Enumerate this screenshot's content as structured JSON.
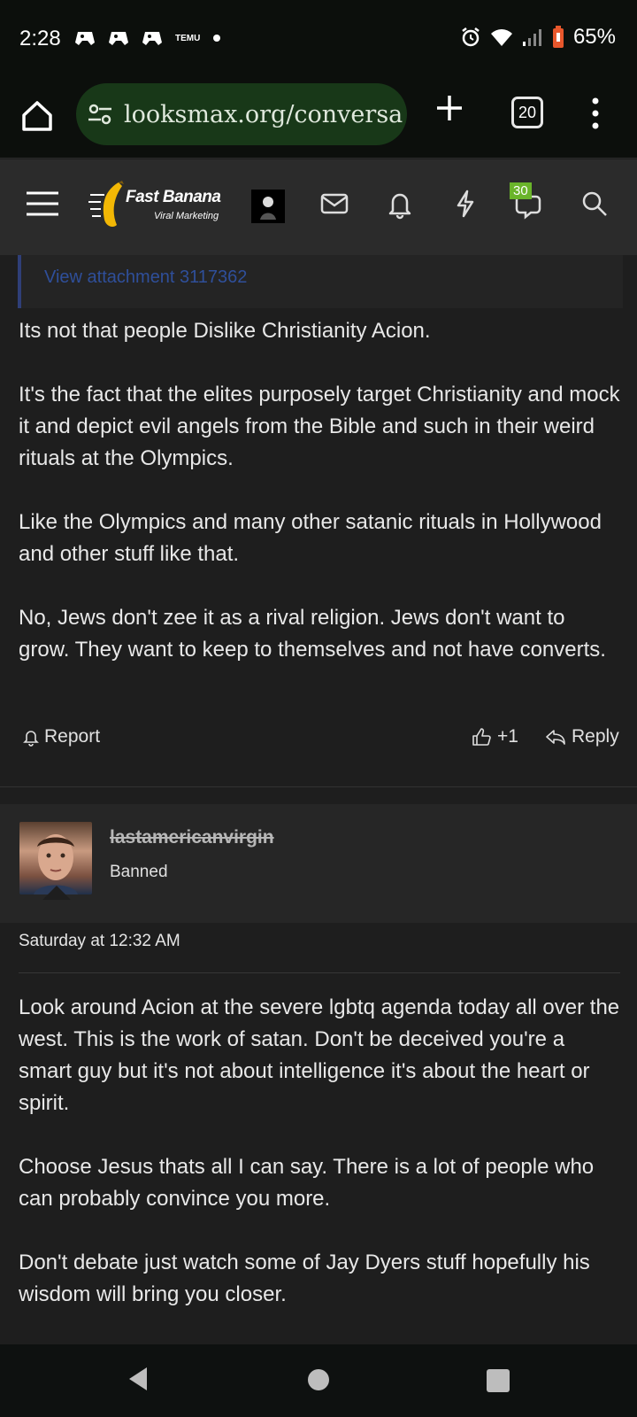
{
  "status_bar": {
    "time": "2:28",
    "battery": "65%",
    "icons": [
      "game-controller-icon",
      "game-controller-icon",
      "game-controller-icon",
      "temu-icon",
      "dot-icon",
      "alarm-icon",
      "wifi-icon",
      "signal-icon",
      "battery-icon"
    ],
    "temu_label": "TEMU"
  },
  "browser": {
    "url": "looksmax.org/conversa",
    "tab_count": "20"
  },
  "site_nav": {
    "logo_line1": "Fast Banana",
    "logo_line2": "Viral Marketing",
    "notification_badge": "30"
  },
  "previous_post": {
    "quote_link": "View attachment 3117362",
    "paragraphs": [
      "Its not that people Dislike Christianity Acion.",
      "It's the fact that the elites purposely target Christianity and mock it and depict evil angels from the Bible and such in their weird rituals at the Olympics.",
      "Like the Olympics and many other satanic rituals in Hollywood and other stuff like that.",
      "No, Jews don't zee it as a rival religion. Jews don't want to grow. They want to keep to themselves and not have converts."
    ],
    "actions": {
      "report": "Report",
      "likes": "+1",
      "reply": "Reply"
    }
  },
  "post": {
    "username": "lastamericanvirgin",
    "user_title": "Banned",
    "date": "Saturday at 12:32 AM",
    "paragraphs": [
      "Look around Acion at the severe lgbtq agenda today all over the west. This is the work of satan. Don't be deceived you're a smart guy but it's not about intelligence it's about the heart or spirit.",
      "Choose Jesus thats all I can say. There is a lot of people who can probably convince you more.",
      "Don't debate just watch some of Jay Dyers stuff hopefully his wisdom will bring you closer."
    ]
  },
  "colors": {
    "background": "#1e1e1e",
    "url_bar": "#183818",
    "badge": "#6ab42a",
    "quote_border": "#2f3f78",
    "link": "#2f4f9a"
  }
}
